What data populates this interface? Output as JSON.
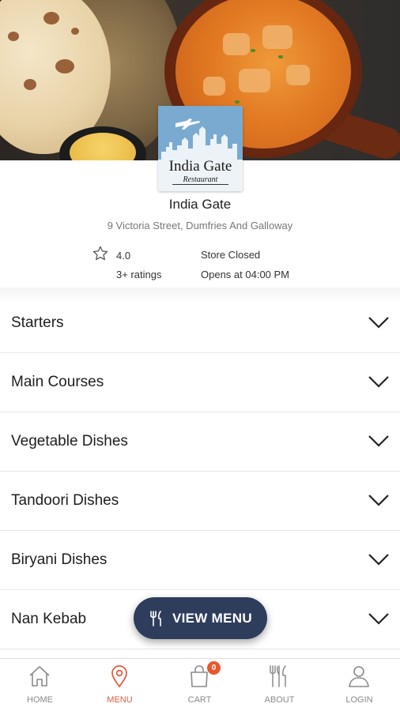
{
  "logo": {
    "name": "India Gate",
    "subtitle": "Restaurant"
  },
  "restaurant": {
    "name": "India Gate",
    "address": "9 Victoria Street, Dumfries And Galloway",
    "rating": "4.0",
    "ratings_count": "3+ ratings",
    "store_status": "Store Closed",
    "opens_at": "Opens at 04:00 PM"
  },
  "categories": [
    {
      "label": "Starters"
    },
    {
      "label": "Main Courses"
    },
    {
      "label": "Vegetable Dishes"
    },
    {
      "label": "Tandoori Dishes"
    },
    {
      "label": "Biryani Dishes"
    },
    {
      "label": "Nan Kebab"
    }
  ],
  "view_menu": {
    "label": "VIEW MENU",
    "icon": "cutlery-icon"
  },
  "bottom_nav": [
    {
      "label": "HOME",
      "icon": "home-icon",
      "active": false
    },
    {
      "label": "MENU",
      "icon": "location-pin-icon",
      "active": true
    },
    {
      "label": "CART",
      "icon": "shopping-bag-icon",
      "active": false,
      "badge": "0"
    },
    {
      "label": "ABOUT",
      "icon": "cutlery-icon",
      "active": false
    },
    {
      "label": "LOGIN",
      "icon": "user-icon",
      "active": false
    }
  ],
  "colors": {
    "accent": "#e5593a",
    "button_bg": "#2e3d5c",
    "badge": "#e8572e"
  }
}
